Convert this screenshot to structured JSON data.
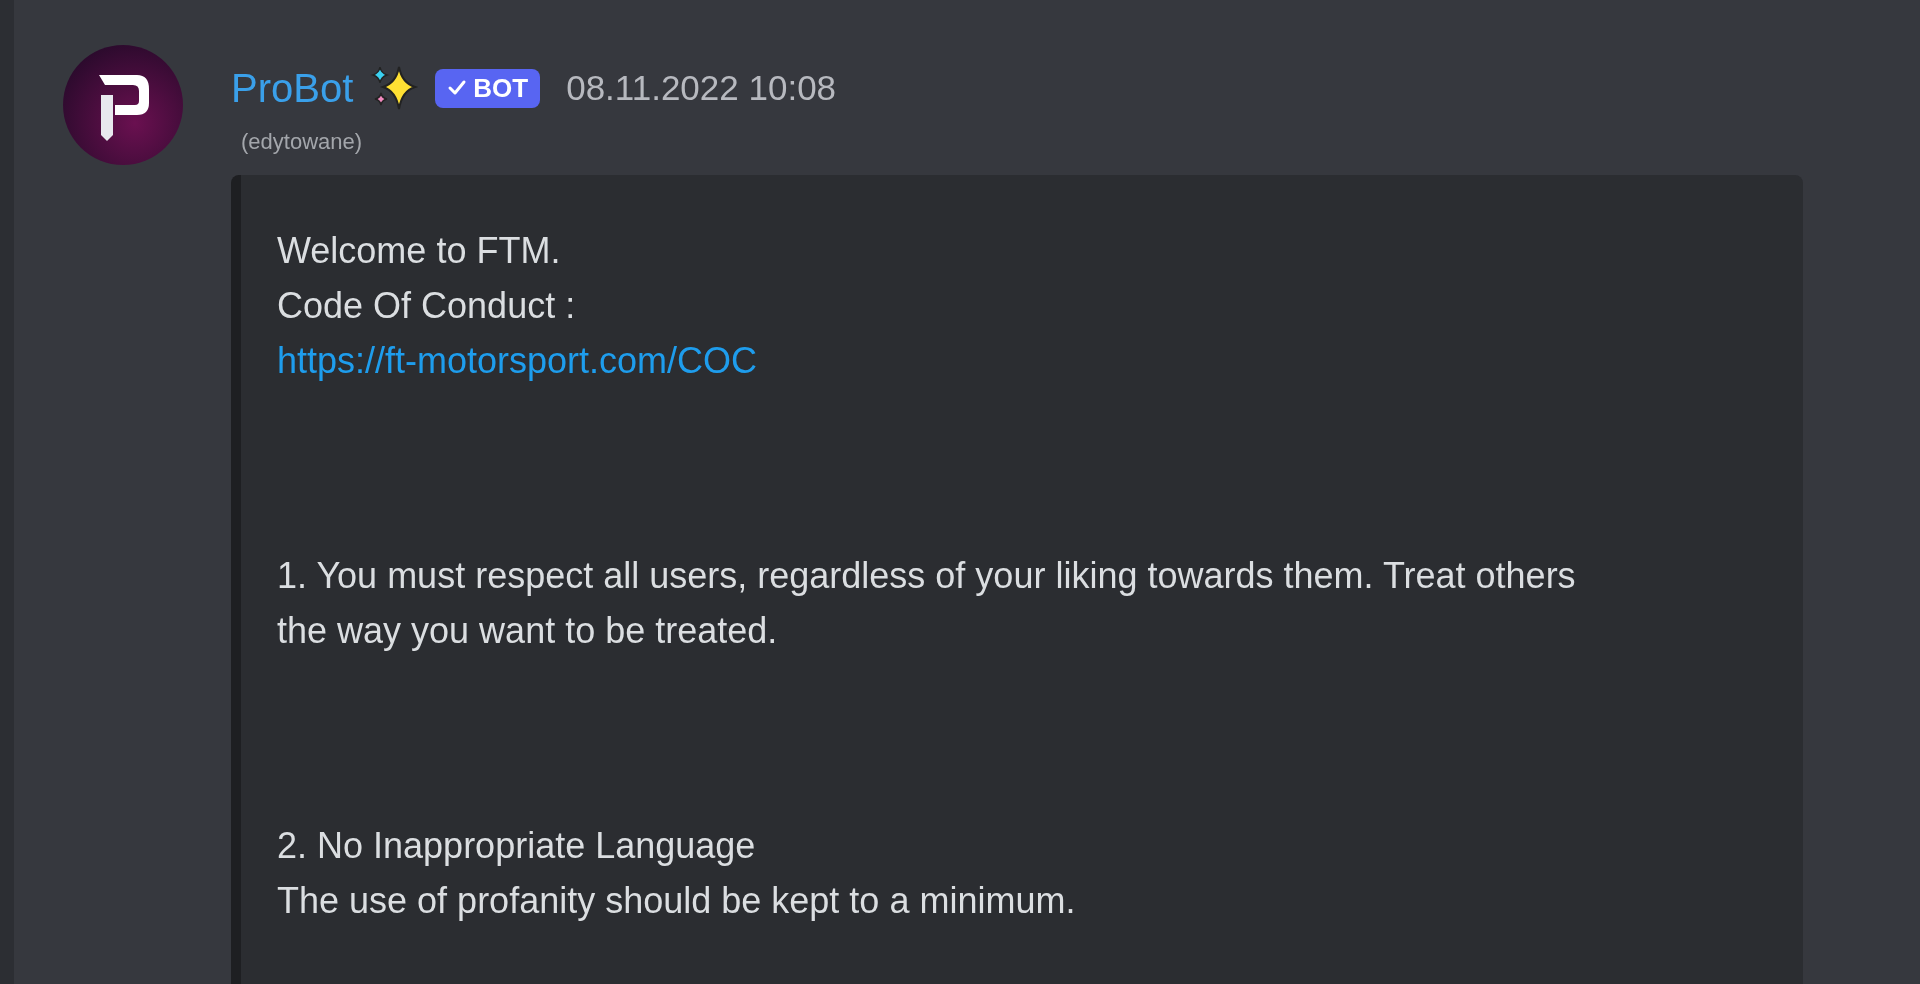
{
  "message": {
    "author": "ProBot",
    "badge": {
      "label": "BOT",
      "verified": true
    },
    "timestamp": "08.11.2022 10:08",
    "edited_note": "(edytowane)"
  },
  "embed": {
    "blocks": [
      {
        "lines": [
          {
            "kind": "text",
            "text": "Welcome to FTM."
          },
          {
            "kind": "text",
            "text": "Code Of Conduct :"
          },
          {
            "kind": "link",
            "text": "https://ft-motorsport.com/COC"
          }
        ]
      },
      {
        "lines": [
          {
            "kind": "text",
            "text": "1. You must respect all users, regardless of your liking towards them. Treat others"
          },
          {
            "kind": "text",
            "text": "the way you want to be treated."
          }
        ]
      },
      {
        "lines": [
          {
            "kind": "text",
            "text": "2. No Inappropriate Language"
          },
          {
            "kind": "text",
            "text": "The use of profanity should be kept to a minimum."
          }
        ]
      }
    ]
  }
}
